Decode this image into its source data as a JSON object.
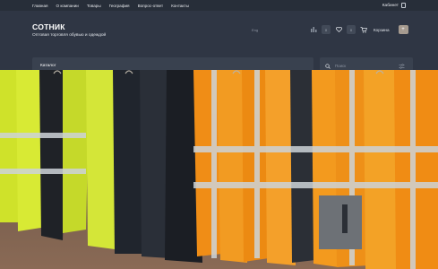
{
  "topnav": {
    "links": [
      "Главная",
      "О компании",
      "Товары",
      "География",
      "Вопрос-ответ",
      "Контакты"
    ],
    "cabinet": "Кабинет"
  },
  "header": {
    "title": "СОТНИК",
    "subtitle": "Оптовая торговля обувью и одеждой",
    "lang": "Eng",
    "compare_count": "0",
    "favorites_count": "0",
    "cart_label": "Корзина",
    "cart_count": "+"
  },
  "catalog": {
    "label": "Каталог"
  },
  "search": {
    "placeholder": "Поиск"
  },
  "colors": {
    "bg": "#2f3644",
    "topbar": "#272e39",
    "field": "#39414f",
    "accent": "#a69b90"
  },
  "hero": {
    "alt": "hi-vis workwear jackets on a rack"
  }
}
